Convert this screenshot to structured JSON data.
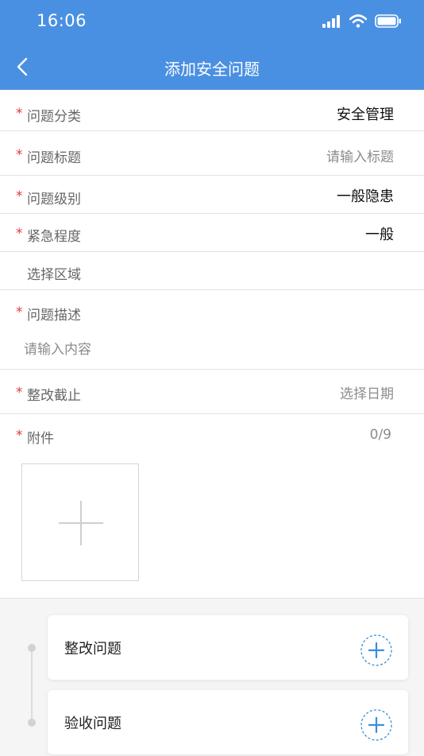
{
  "status_bar": {
    "time": "16:06"
  },
  "nav": {
    "title": "添加安全问题"
  },
  "colors": {
    "primary": "#4a90e2",
    "required": "#e03b3b",
    "accent_icon": "#3a8fd6"
  },
  "form": {
    "required_mark": "*",
    "category": {
      "label": "问题分类",
      "value": "安全管理"
    },
    "title": {
      "label": "问题标题",
      "placeholder": "请输入标题"
    },
    "level": {
      "label": "问题级别",
      "value": "一般隐患"
    },
    "urgency": {
      "label": "紧急程度",
      "value": "一般"
    },
    "area": {
      "label": "选择区域"
    },
    "description": {
      "label": "问题描述",
      "placeholder": "请输入内容"
    },
    "deadline": {
      "label": "整改截止",
      "placeholder": "选择日期"
    },
    "attachment": {
      "label": "附件",
      "count": "0/9"
    }
  },
  "cards": [
    {
      "title": "整改问题",
      "icon": "add-circle-icon"
    },
    {
      "title": "验收问题",
      "icon": "add-circle-icon"
    }
  ]
}
